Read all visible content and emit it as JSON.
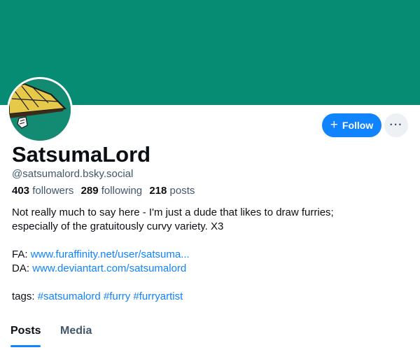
{
  "profile": {
    "display_name": "SatsumaLord",
    "handle": "@satsumalord.bsky.social",
    "stats": {
      "followers_count": "403",
      "followers_label": "followers",
      "following_count": "289",
      "following_label": "following",
      "posts_count": "218",
      "posts_label": "posts"
    },
    "bio": {
      "line1": "Not really much to say here - I'm just a dude that likes to draw furries;",
      "line2": "especially of the gratuitously curvy variety. X3",
      "fa_label": "FA: ",
      "fa_link": "www.furaffinity.net/user/satsuma...",
      "da_label": "DA: ",
      "da_link": "www.deviantart.com/satsumalord",
      "tags_label": "tags: ",
      "tags": [
        "#satsumalord",
        "#furry",
        "#furryartist"
      ]
    }
  },
  "actions": {
    "follow_label": "Follow",
    "more_icon": "ellipsis-icon"
  },
  "tabs": [
    {
      "label": "Posts",
      "active": true
    },
    {
      "label": "Media",
      "active": false
    }
  ],
  "colors": {
    "banner": "#058c72",
    "accent": "#1083fe",
    "muted_text": "#42576c",
    "text": "#0b0f14"
  }
}
